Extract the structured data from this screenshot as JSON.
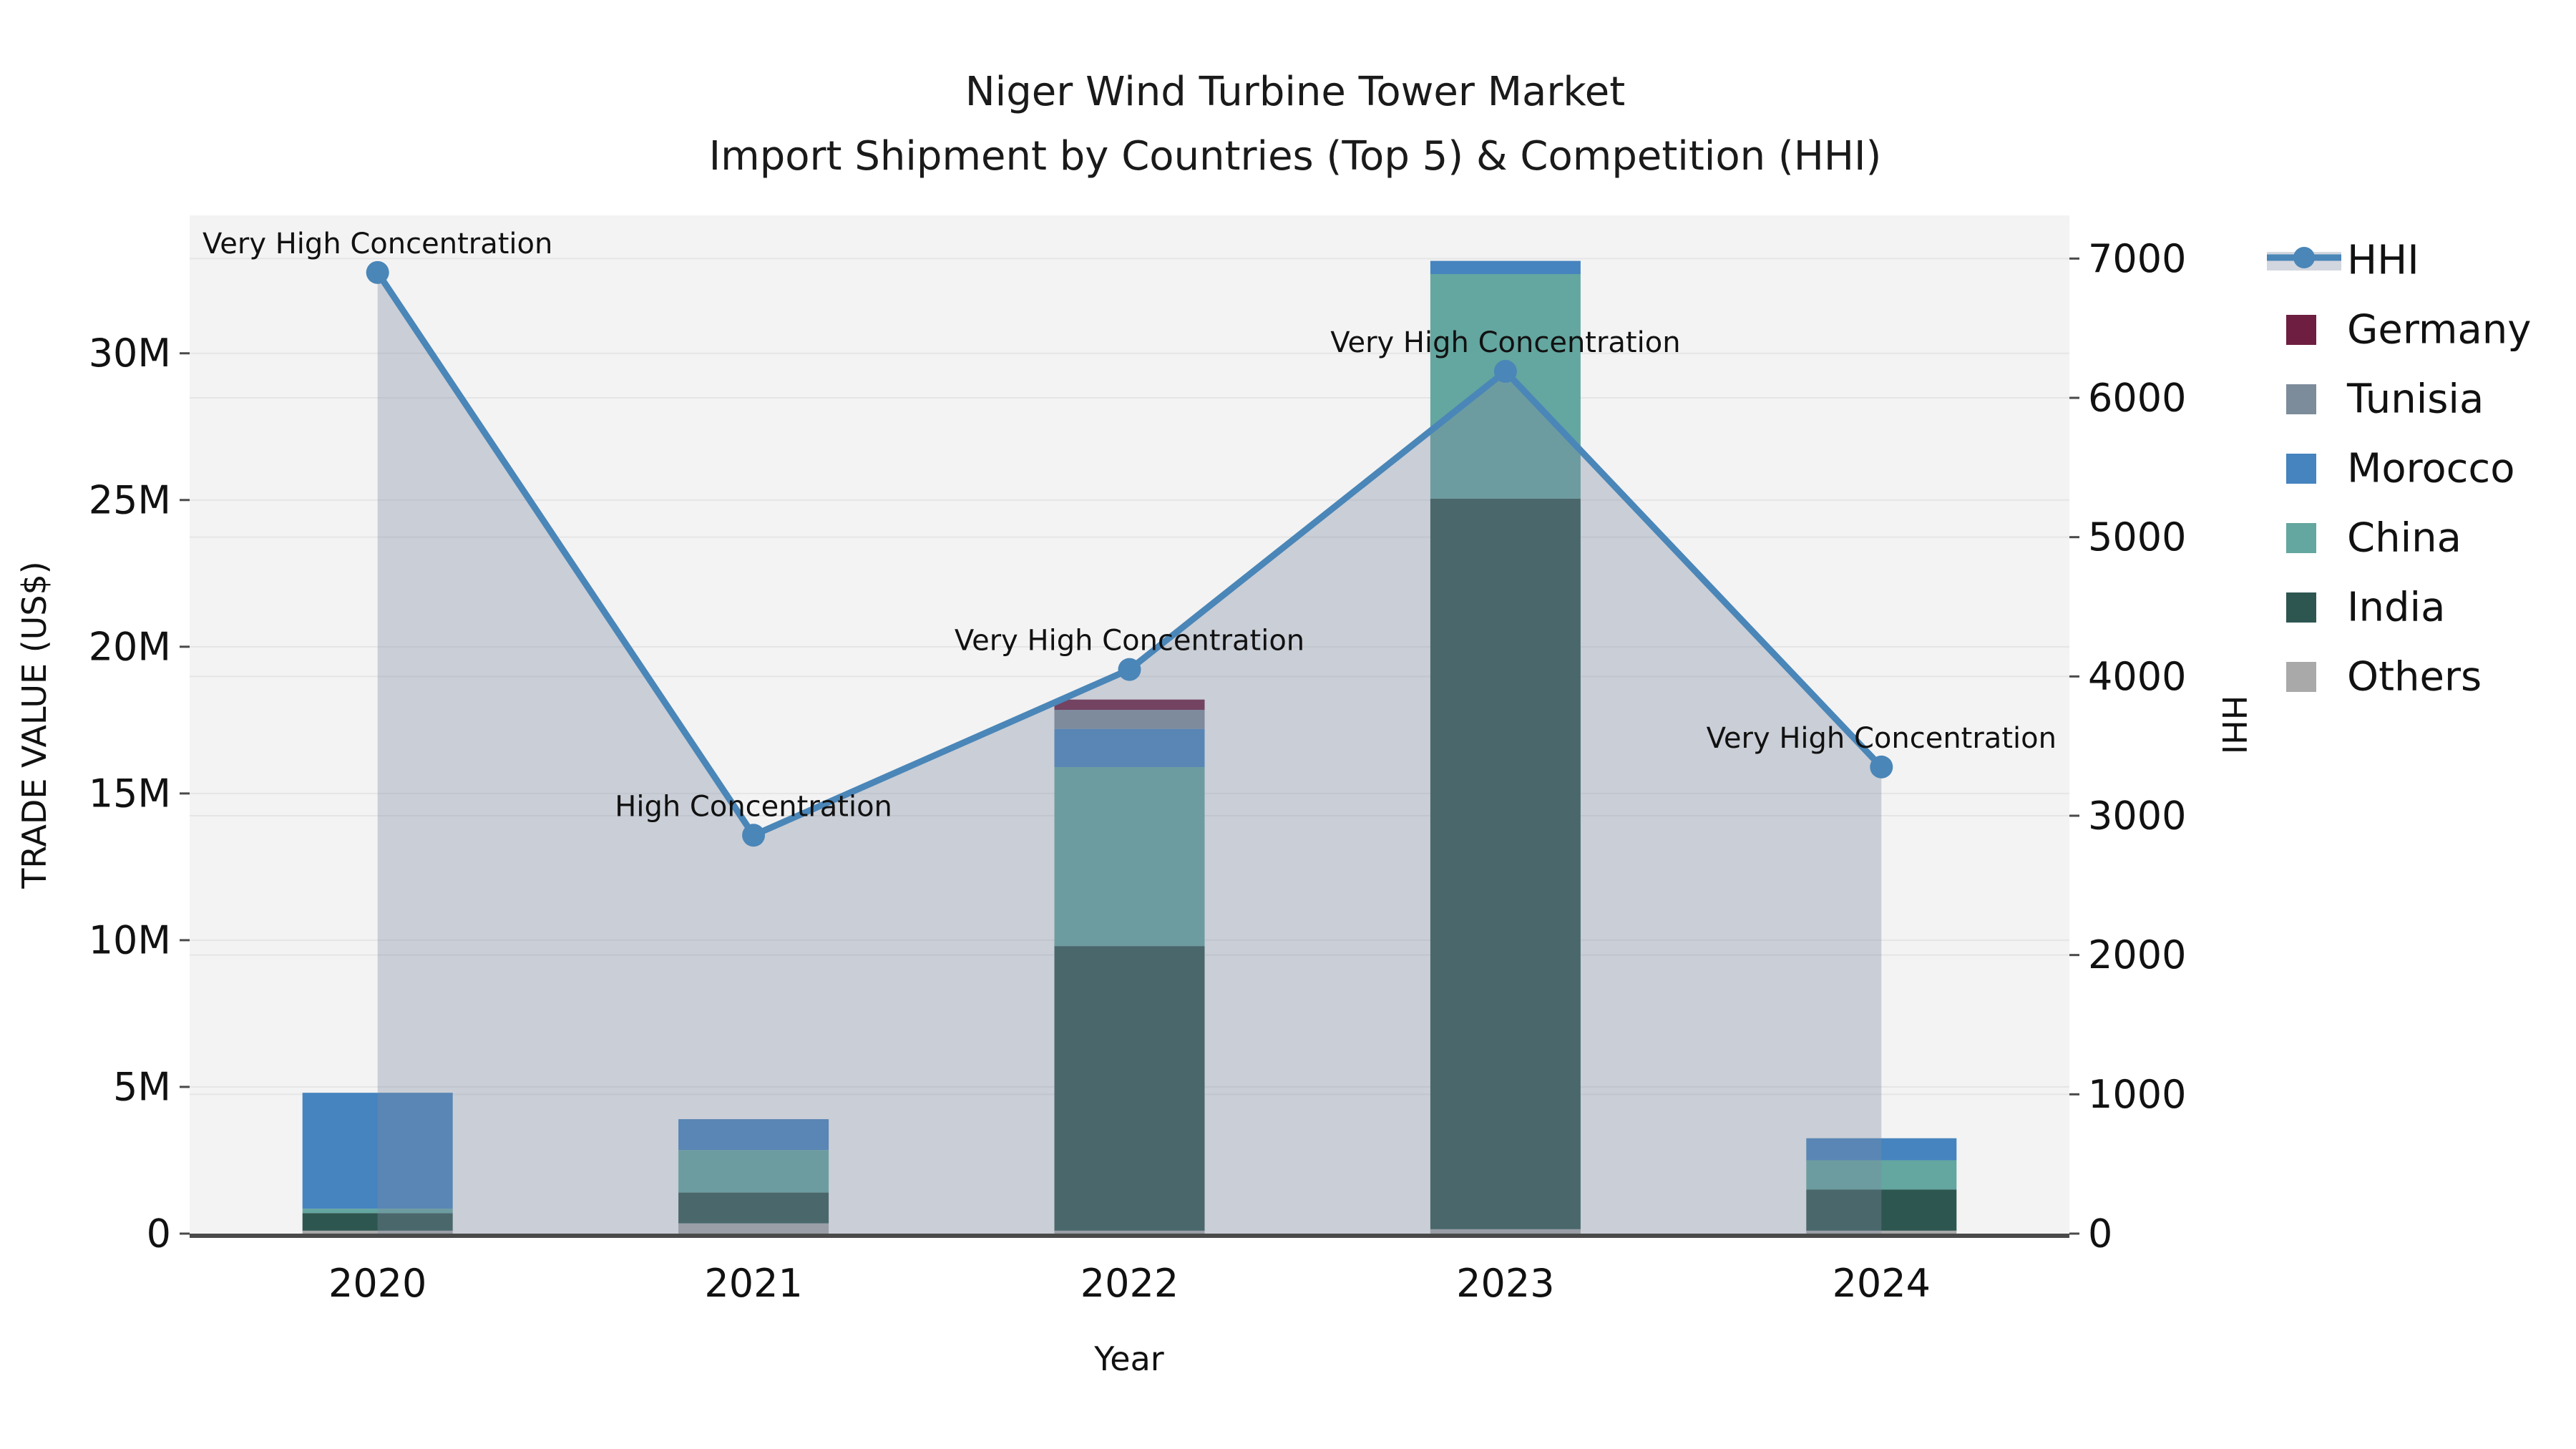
{
  "title": {
    "line1": "Niger Wind Turbine Tower Market",
    "line2": "Import Shipment by Countries (Top 5) & Competition (HHI)"
  },
  "chart_data": {
    "type": "combo-stacked-bar-line",
    "categories": [
      "2020",
      "2021",
      "2022",
      "2023",
      "2024"
    ],
    "bar_value_unit": "million US$",
    "bar_series": [
      {
        "name": "Others",
        "color": "#a9a9a9",
        "values": [
          0.1,
          0.35,
          0.1,
          0.15,
          0.1
        ]
      },
      {
        "name": "India",
        "color": "#2e5651",
        "values": [
          0.6,
          1.05,
          9.7,
          24.9,
          1.4
        ]
      },
      {
        "name": "China",
        "color": "#64a6a0",
        "values": [
          0.15,
          1.45,
          6.1,
          7.65,
          1.0
        ]
      },
      {
        "name": "Morocco",
        "color": "#4584bf",
        "values": [
          3.95,
          1.05,
          1.3,
          0.45,
          0.75
        ]
      },
      {
        "name": "Tunisia",
        "color": "#7d8c9b",
        "values": [
          0,
          0,
          0.65,
          0,
          0
        ]
      },
      {
        "name": "Germany",
        "color": "#6e1e40",
        "values": [
          0,
          0,
          0.35,
          0,
          0
        ]
      }
    ],
    "line_series": {
      "name": "HHI",
      "color": "#4a86b8",
      "area_fill": "rgba(126,137,160,0.35)",
      "values": [
        6900,
        2860,
        4050,
        6190,
        3350
      ]
    },
    "annotations": [
      "Very High Concentration",
      "High Concentration",
      "Very High Concentration",
      "Very High Concentration",
      "Very High Concentration"
    ],
    "left_axis": {
      "label": "TRADE VALUE (US$)",
      "ticks": [
        "0",
        "5M",
        "10M",
        "15M",
        "20M",
        "25M",
        "30M"
      ],
      "tick_values": [
        0,
        5,
        10,
        15,
        20,
        25,
        30
      ],
      "max": 34.7
    },
    "right_axis": {
      "label": "HHI",
      "ticks": [
        "0",
        "1000",
        "2000",
        "3000",
        "4000",
        "5000",
        "6000",
        "7000"
      ],
      "tick_values": [
        0,
        1000,
        2000,
        3000,
        4000,
        5000,
        6000,
        7000
      ],
      "max": 7310
    },
    "x_axis": {
      "label": "Year"
    },
    "legend": [
      {
        "label": "HHI",
        "type": "line"
      },
      {
        "label": "Germany",
        "type": "swatch",
        "color": "#6e1e40"
      },
      {
        "label": "Tunisia",
        "type": "swatch",
        "color": "#7d8c9b"
      },
      {
        "label": "Morocco",
        "type": "swatch",
        "color": "#4584bf"
      },
      {
        "label": "China",
        "type": "swatch",
        "color": "#64a6a0"
      },
      {
        "label": "India",
        "type": "swatch",
        "color": "#2e5651"
      },
      {
        "label": "Others",
        "type": "swatch",
        "color": "#a9a9a9"
      }
    ],
    "style": {
      "plot_bg": "#f3f3f3",
      "grid_color": "#e5e5e5",
      "axis_line_color": "#4a4a4a"
    }
  }
}
